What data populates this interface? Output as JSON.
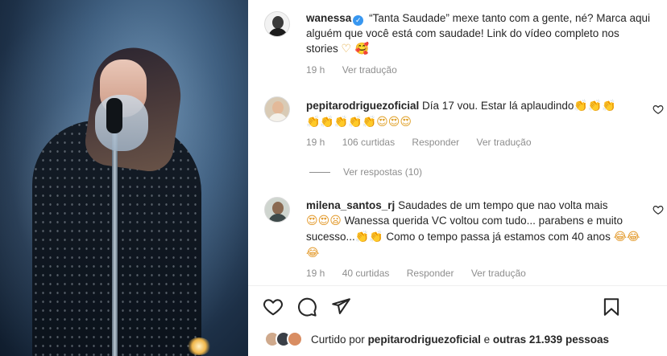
{
  "post": {
    "author": "wanessa",
    "caption": "“Tanta Saudade” mexe tanto com a gente, né? Marca aqui alguém que você está com saudade! Link do vídeo completo nos stories",
    "caption_emojis": "♡ 🥰",
    "time": "19 h",
    "translate": "Ver tradução"
  },
  "comments": [
    {
      "user": "pepitarodriguezoficial",
      "text": "Día 17 vou. Estar lá aplaudindo",
      "emojis_inline": "👏👏👏",
      "emojis_line2": "👏👏👏👏👏😍😍😍",
      "time": "19 h",
      "likes": "106 curtidas",
      "reply": "Responder",
      "translate": "Ver tradução",
      "view_replies": "Ver respostas (10)"
    },
    {
      "user": "milena_santos_rj",
      "text_1": "Saudades de um tempo que nao volta mais",
      "emojis_1": "😍😍😦",
      "text_2": "Wanessa querida VC voltou com tudo... parabens e muito sucesso...",
      "emojis_2": "👏👏",
      "text_3": "Como o tempo passa já estamos com 40 anos",
      "emojis_3": "😂😂😂",
      "time": "19 h",
      "likes": "40 curtidas",
      "reply": "Responder",
      "translate": "Ver tradução"
    }
  ],
  "likes": {
    "prefix": "Curtido por",
    "user": "pepitarodriguezoficial",
    "middle": "e",
    "others": "outras 21.939 pessoas"
  },
  "icons": {
    "like": "heart-icon",
    "comment": "comment-icon",
    "share": "share-icon",
    "save": "bookmark-icon",
    "verified": "verified-badge-icon",
    "comment_like": "heart-outline-icon"
  },
  "colors": {
    "verified_blue": "#3897f0",
    "muted_text": "#8e8e8e",
    "text": "#262626"
  }
}
